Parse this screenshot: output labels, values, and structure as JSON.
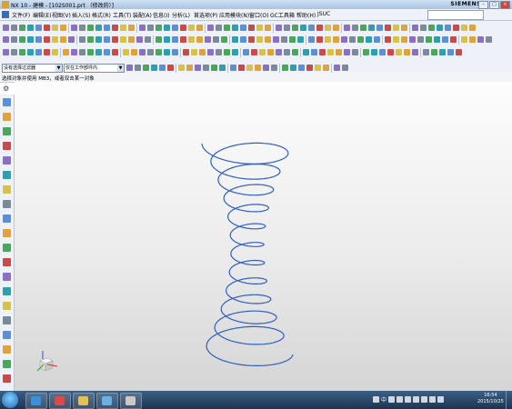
{
  "window": {
    "title": "NX 10 - 建模 - [102S001.prt （修改的）]",
    "brand": "SIEMENS",
    "controls": [
      "–",
      "□",
      "×"
    ]
  },
  "menubar": {
    "items": [
      "文件(F)",
      "编辑(E)",
      "视图(V)",
      "插入(S)",
      "格式(R)",
      "工具(T)",
      "装配(A)",
      "信息(I)",
      "分析(L)",
      "首选项(P)",
      "应用模块(N)",
      "窗口(O)",
      "GC工具箱",
      "帮助(H)",
      "JSUC"
    ]
  },
  "selection_bar": {
    "filter": "没有选择过滤器",
    "scope": "仅在工作部件内"
  },
  "cue_line": {
    "text": "选择对象并使用 MB3，或者双击某一对象"
  },
  "graphics": {
    "background_top": "#fdfdfd",
    "background_bottom": "#d5d5d5",
    "curve_color": "#2f5fc4",
    "triad_labels": [
      "Z",
      "Y",
      "X"
    ]
  },
  "taskbar": {
    "ime": "中",
    "clock_time": "16:54",
    "clock_date": "2015/10/25"
  },
  "icons": [
    "nx-app-icon",
    "start-orb",
    "gear-icon",
    "helix-curve",
    "coordinate-triad-icon"
  ]
}
